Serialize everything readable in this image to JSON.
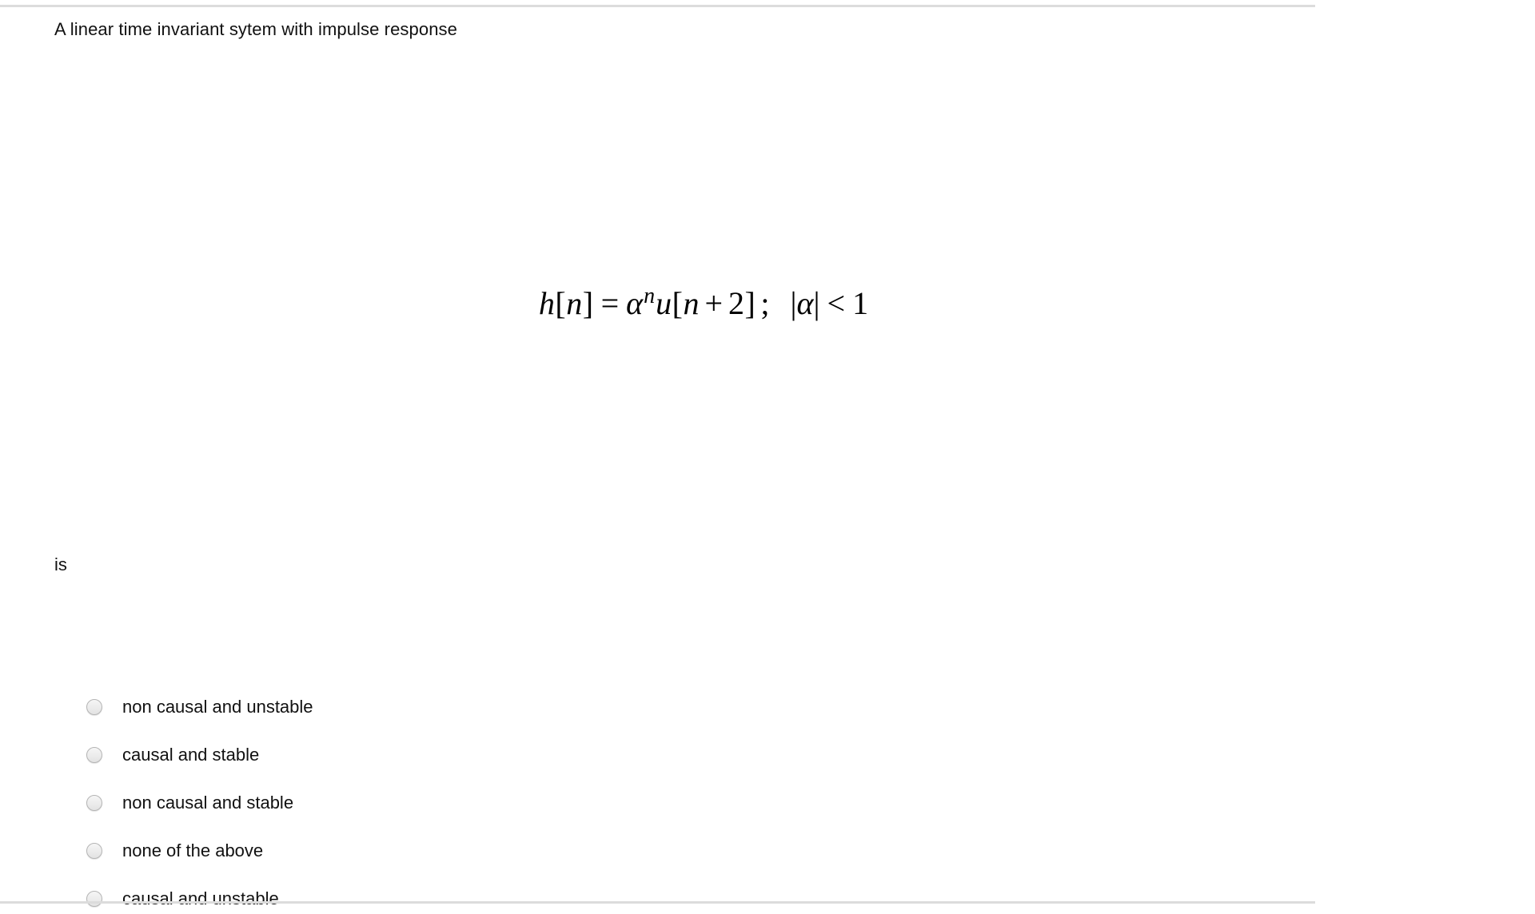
{
  "question": {
    "stem": "A linear time invariant sytem with impulse response",
    "tail": "is",
    "formula": {
      "alt": "h[n] = α^n u[n + 2] ;  |α| < 1",
      "lhs_h": "h",
      "lhs_open": "[",
      "lhs_n": "n",
      "lhs_close": "]",
      "equals": "=",
      "base_alpha": "α",
      "exponent_n": "n",
      "u": "u",
      "arg_open": "[",
      "arg_n": "n",
      "plus": "+",
      "arg_two": "2",
      "arg_close": "]",
      "semicolon": ";",
      "abs_open": "|",
      "abs_alpha": "α",
      "abs_close": "|",
      "less_than": "<",
      "one": "1"
    }
  },
  "options": [
    {
      "label": "non causal and unstable",
      "selected": false
    },
    {
      "label": "causal and stable",
      "selected": false
    },
    {
      "label": "non causal and stable",
      "selected": false
    },
    {
      "label": "none of the above",
      "selected": false
    },
    {
      "label": "causal and unstable",
      "selected": false
    }
  ],
  "colors": {
    "background": "#ffffff",
    "text": "#111111",
    "rule": "#dcdcdc",
    "radio_border": "#b4b4b4",
    "radio_fill": "#ececec"
  }
}
